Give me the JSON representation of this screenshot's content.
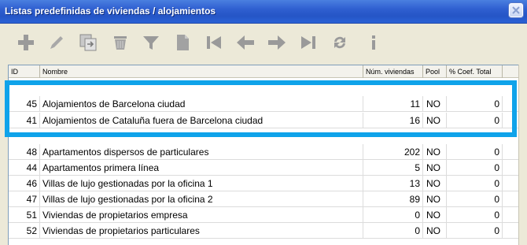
{
  "window": {
    "title": "Listas predefinidas de viviendas / alojamientos"
  },
  "toolbar": {
    "buttons": [
      {
        "name": "add-icon",
        "label": "Añadir"
      },
      {
        "name": "edit-icon",
        "label": "Editar"
      },
      {
        "name": "copy-icon",
        "label": "Copiar"
      },
      {
        "name": "delete-icon",
        "label": "Borrar"
      },
      {
        "name": "filter-icon",
        "label": "Filtrar"
      },
      {
        "name": "document-icon",
        "label": "Documento"
      },
      {
        "name": "first-record-icon",
        "label": "Primero"
      },
      {
        "name": "previous-record-icon",
        "label": "Anterior"
      },
      {
        "name": "next-record-icon",
        "label": "Siguiente"
      },
      {
        "name": "last-record-icon",
        "label": "Último"
      },
      {
        "name": "refresh-icon",
        "label": "Actualizar"
      },
      {
        "name": "info-icon",
        "label": "Información"
      }
    ]
  },
  "table": {
    "headers": {
      "id": "ID",
      "name": "Nombre",
      "num": "Núm. viviendas",
      "pool": "Pool",
      "coef": "% Coef. Total"
    },
    "rows": [
      {
        "id": "45",
        "name": "Alojamientos de Barcelona ciudad",
        "num": "11",
        "pool": "NO",
        "coef": "0"
      },
      {
        "id": "41",
        "name": "Alojamientos de Cataluña fuera de Barcelona ciudad",
        "num": "16",
        "pool": "NO",
        "coef": "0"
      },
      {
        "id": "48",
        "name": "Apartamentos dispersos de particulares",
        "num": "202",
        "pool": "NO",
        "coef": "0"
      },
      {
        "id": "44",
        "name": "Apartamentos primera línea",
        "num": "5",
        "pool": "NO",
        "coef": "0"
      },
      {
        "id": "46",
        "name": "Villas de lujo gestionadas por la oficina 1",
        "num": "13",
        "pool": "NO",
        "coef": "0"
      },
      {
        "id": "47",
        "name": "Villas de lujo gestionadas por la oficina 2",
        "num": "89",
        "pool": "NO",
        "coef": "0"
      },
      {
        "id": "51",
        "name": "Viviendas de propietarios empresa",
        "num": "0",
        "pool": "NO",
        "coef": "0"
      },
      {
        "id": "52",
        "name": "Viviendas de propietarios particulares",
        "num": "0",
        "pool": "NO",
        "coef": "0"
      }
    ]
  },
  "colors": {
    "titlebar": "#2555c6",
    "highlight": "#0fa3ea",
    "icon_gray": "#9a9a9a"
  }
}
